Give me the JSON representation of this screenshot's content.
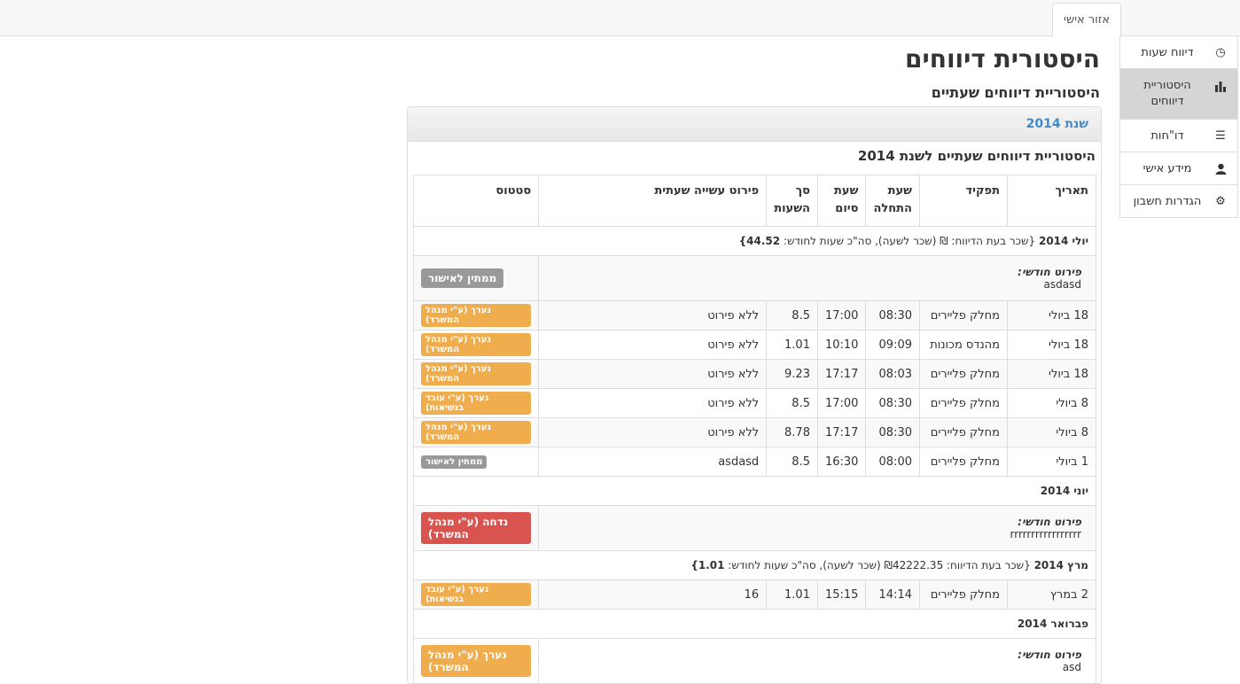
{
  "top": {
    "tab_label": "אזור אישי"
  },
  "sidebar": {
    "items": [
      {
        "label": "דיווח שעות",
        "icon": "clock-icon"
      },
      {
        "label": "היסטוריית דיווחים",
        "icon": "bar-chart-icon"
      },
      {
        "label": "דו\"חות",
        "icon": "list-icon"
      },
      {
        "label": "מידע אישי",
        "icon": "user-icon"
      },
      {
        "label": "הגדרות חשבון",
        "icon": "gear-icon"
      }
    ]
  },
  "page": {
    "title": "היסטורית דיווחים",
    "subtitle": "היסטוריית דיווחים שעתיים",
    "panel_head": "שנת 2014",
    "panel_title": "היסטוריית דיווחים שעתיים לשנת 2014"
  },
  "table": {
    "headers": [
      "תאריך",
      "תפקיד",
      "שעת התחלה",
      "שעת סיום",
      "סך השעות",
      "פירוט עשייה שעתית",
      "סטטוס"
    ],
    "detail_label": "פירוט חודשי:",
    "july": {
      "name": "יולי 2014",
      "info": "{שכר בעת הדיווח: ₪ (שכר לשעה), סה\"כ שעות לחודש:",
      "total": "44.52}",
      "detail_value": "asdasd",
      "detail_status": "ממתין לאישור",
      "rows": [
        {
          "date": "18 ביולי",
          "role": "מחלק פליירים",
          "start": "08:30",
          "end": "17:00",
          "total": "8.5",
          "desc": "ללא פירוט",
          "status": "נערך (ע\"י מנהל המשרד)"
        },
        {
          "date": "18 ביולי",
          "role": "מהנדס מכונות",
          "start": "09:09",
          "end": "10:10",
          "total": "1.01",
          "desc": "ללא פירוט",
          "status": "נערך (ע\"י מנהל המשרד)"
        },
        {
          "date": "18 ביולי",
          "role": "מחלק פליירים",
          "start": "08:03",
          "end": "17:17",
          "total": "9.23",
          "desc": "ללא פירוט",
          "status": "נערך (ע\"י מנהל המשרד)"
        },
        {
          "date": "8 ביולי",
          "role": "מחלק פליירים",
          "start": "08:30",
          "end": "17:00",
          "total": "8.5",
          "desc": "ללא פירוט",
          "status": "נערך (ע\"י עובד בנשיאות)"
        },
        {
          "date": "8 ביולי",
          "role": "מחלק פליירים",
          "start": "08:30",
          "end": "17:17",
          "total": "8.78",
          "desc": "ללא פירוט",
          "status": "נערך (ע\"י מנהל המשרד)"
        },
        {
          "date": "1 ביולי",
          "role": "מחלק פליירים",
          "start": "08:00",
          "end": "16:30",
          "total": "8.5",
          "desc": "asdasd",
          "status": "ממתין לאישור"
        }
      ]
    },
    "june": {
      "name": "יוני 2014",
      "detail_value": "rrrrrrrrrrrrrrrrr",
      "detail_status": "נדחה (ע\"י מנהל המשרד)"
    },
    "march": {
      "name": "מרץ 2014",
      "info": "{שכר בעת הדיווח: ₪42222.35 (שכר לשעה), סה\"כ שעות לחודש:",
      "total": "1.01}",
      "row": {
        "date": "2 במרץ",
        "role": "מחלק פליירים",
        "start": "14:14",
        "end": "15:15",
        "total": "1.01",
        "desc": "16",
        "status": "נערך (ע\"י עובד בנשיאות)"
      }
    },
    "feb": {
      "name": "פברואר 2014",
      "detail_value": "asd",
      "detail_status": "נערך (ע\"י מנהל המשרד)"
    }
  }
}
